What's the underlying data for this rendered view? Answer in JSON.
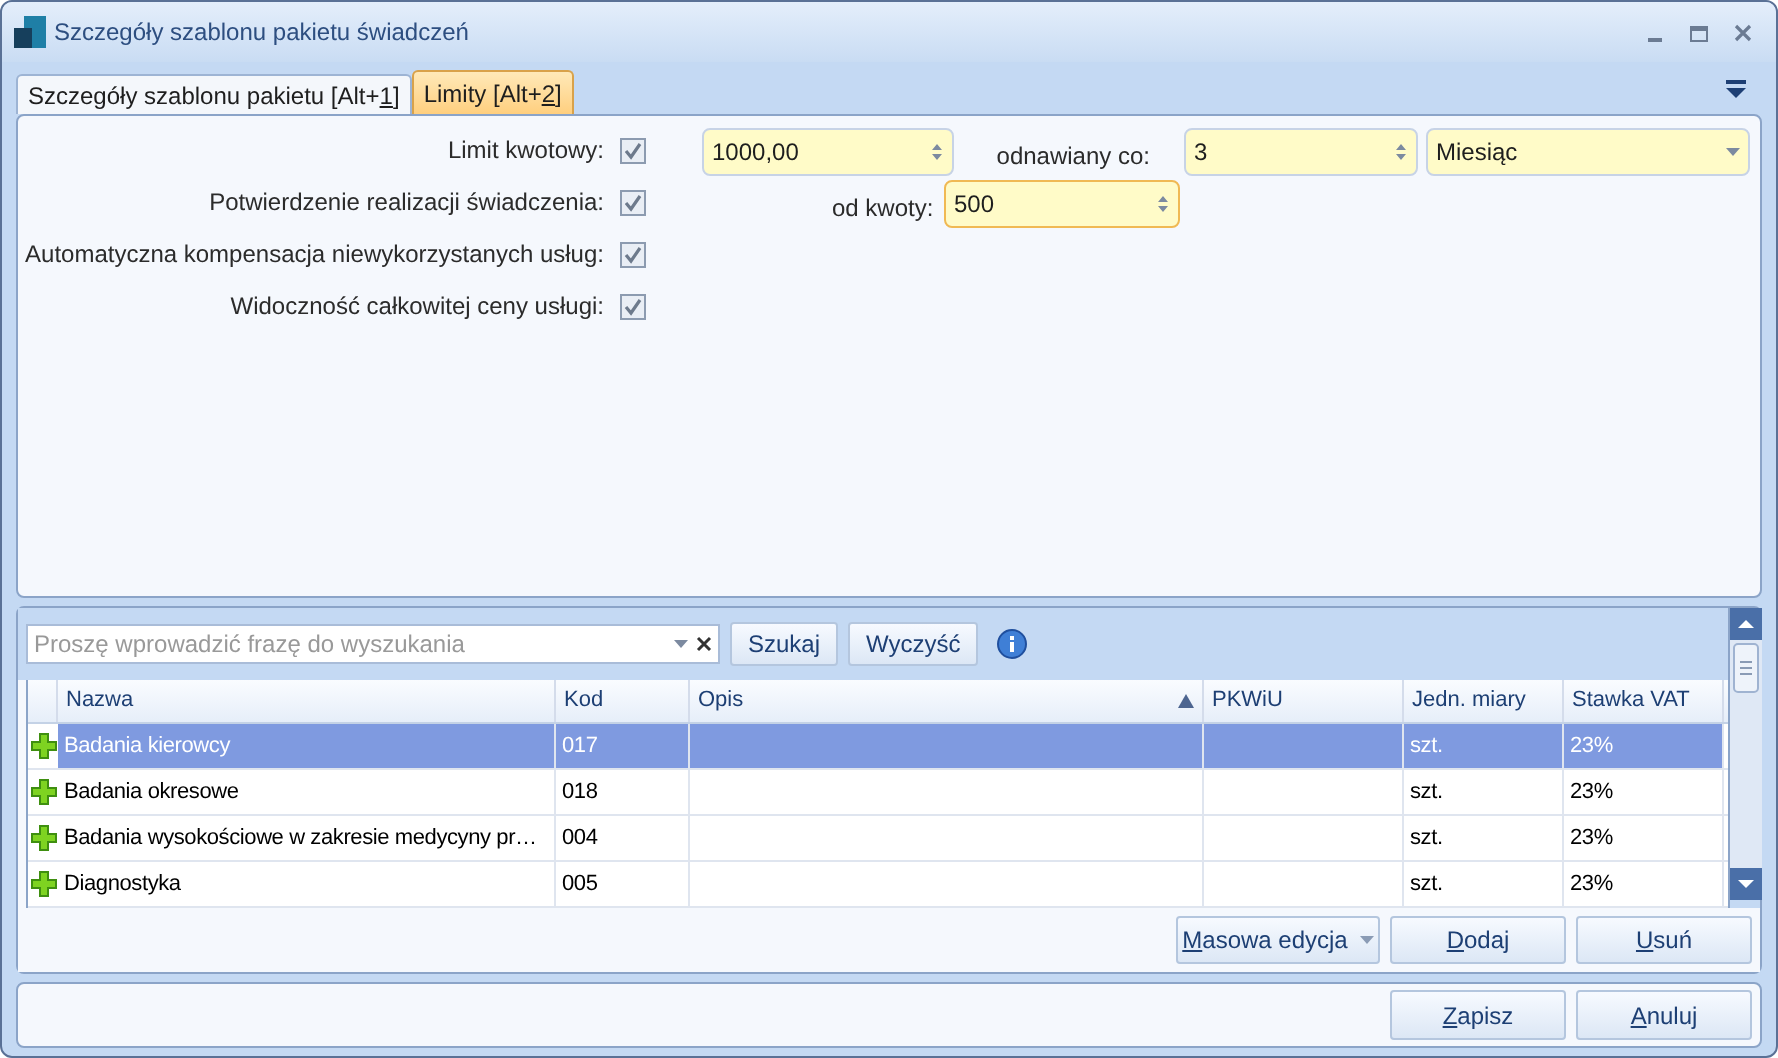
{
  "window": {
    "title": "Szczegóły szablonu pakietu świadczeń"
  },
  "tabs": [
    {
      "before": "Szczegóły szablonu pakietu [Alt+",
      "key": "1",
      "after": "]",
      "selected": false
    },
    {
      "before": "Limity [Alt+",
      "key": "2",
      "after": "]",
      "selected": true
    }
  ],
  "options": [
    {
      "label": "Limit kwotowy:",
      "checked": true
    },
    {
      "label": "Potwierdzenie realizacji świadczenia:",
      "checked": true
    },
    {
      "label": "Automatyczna kompensacja niewykorzystanych usług:",
      "checked": true
    },
    {
      "label": "Widoczność całkowitej ceny usługi:",
      "checked": true
    }
  ],
  "limit_amount": {
    "value": "1000,00"
  },
  "renewed_every": {
    "label": "odnawiany co:",
    "value": "3",
    "unit": "Miesiąc"
  },
  "from_amount": {
    "label": "od kwoty:",
    "value": "500"
  },
  "search": {
    "placeholder": "Proszę wprowadzić frazę do wyszukania",
    "buttons": [
      "Szukaj",
      "Wyczyść"
    ]
  },
  "table": {
    "columns": [
      {
        "label": "Nazwa",
        "sorted": false
      },
      {
        "label": "Kod",
        "sorted": false
      },
      {
        "label": "Opis",
        "sorted": true
      },
      {
        "label": "PKWiU",
        "sorted": false
      },
      {
        "label": "Jedn. miary",
        "sorted": false
      },
      {
        "label": "Stawka VAT",
        "sorted": false
      }
    ],
    "rows": [
      {
        "selected": true,
        "cells": [
          "Badania kierowcy",
          "017",
          "",
          "",
          "szt.",
          "23%"
        ]
      },
      {
        "selected": false,
        "cells": [
          "Badania okresowe",
          "018",
          "",
          "",
          "szt.",
          "23%"
        ]
      },
      {
        "selected": false,
        "cells": [
          "Badania wysokościowe w zakresie medycyny pr…",
          "004",
          "",
          "",
          "szt.",
          "23%"
        ]
      },
      {
        "selected": false,
        "cells": [
          "Diagnostyka",
          "005",
          "",
          "",
          "szt.",
          "23%"
        ]
      }
    ]
  },
  "grid_buttons": [
    {
      "key": "M",
      "after": "asowa edycja",
      "kind": "dropdown"
    },
    {
      "key": "D",
      "after": "odaj",
      "kind": "plain"
    },
    {
      "key": "U",
      "after": "suń",
      "kind": "plain"
    }
  ],
  "footer_buttons": [
    {
      "key": "Z",
      "after": "apisz"
    },
    {
      "key": "A",
      "after": "nuluj"
    }
  ]
}
